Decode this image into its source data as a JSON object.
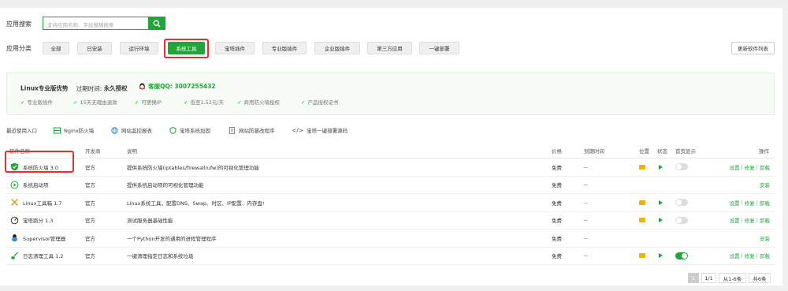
{
  "search": {
    "label": "应用搜索",
    "placeholder": "支持应用名称、字段模糊搜索"
  },
  "categories": {
    "label": "应用分类",
    "items": [
      "全部",
      "已安装",
      "运行环境",
      "系统工具",
      "宝塔插件",
      "专业版插件",
      "企业版插件",
      "第三方应用",
      "一键部署"
    ],
    "active": "系统工具"
  },
  "refresh_label": "更新软件列表",
  "promo": {
    "edition": "Linux专业版优势",
    "expire_label": "过期时间:",
    "expire_value": "永久授权",
    "support": "客服QQ: 3007255432",
    "features": [
      "专业版插件",
      "15天无理由退款",
      "可更换IP",
      "低至1.52元/天",
      "商用防火墙授权",
      "产品授权证书"
    ]
  },
  "recent": {
    "label": "最近使用入口",
    "items": [
      "Nginx防火墙",
      "网站监控报表",
      "宝塔系统加固",
      "网站防篡改程序",
      "宝塔一键部署源码"
    ]
  },
  "table": {
    "headers": [
      "软件名称",
      "开发商",
      "说明",
      "价格",
      "到期时间",
      "位置",
      "状态",
      "首页显示",
      "操作"
    ],
    "rows": [
      {
        "name": "系统防火墙 3.0",
        "vendor": "官方",
        "desc": "提供系统防火墙(iptables/firewall/ufw)的可视化管理功能",
        "price": "免费",
        "expire": "--",
        "folder": true,
        "play": true,
        "toggle": "off",
        "ops": [
          "设置",
          "修复",
          "卸载"
        ]
      },
      {
        "name": "系统启动项",
        "vendor": "官方",
        "desc": "提供系统启动项的可视化管理功能",
        "price": "免费",
        "expire": "--",
        "folder": false,
        "play": false,
        "toggle": "none",
        "ops": [
          "安装"
        ]
      },
      {
        "name": "Linux工具箱 1.7",
        "vendor": "官方",
        "desc": "Linux系统工具，配置DNS、Swap、时区、IP配置、内存盘!",
        "price": "免费",
        "expire": "--",
        "folder": true,
        "play": true,
        "toggle": "off",
        "ops": [
          "设置",
          "修复",
          "卸载"
        ]
      },
      {
        "name": "宝塔跑分 1.3",
        "vendor": "官方",
        "desc": "测试服务器基础性能",
        "price": "免费",
        "expire": "--",
        "folder": true,
        "play": true,
        "toggle": "off",
        "ops": [
          "设置",
          "修复",
          "卸载"
        ]
      },
      {
        "name": "Supervisor管理器",
        "vendor": "官方",
        "desc": "一个Python开发的通用的进程管理程序",
        "price": "免费",
        "expire": "--",
        "folder": false,
        "play": false,
        "toggle": "none",
        "ops": [
          "安装"
        ]
      },
      {
        "name": "日志清理工具 1.2",
        "vendor": "官方",
        "desc": "一键清理指定日志和系统垃圾",
        "price": "免费",
        "expire": "--",
        "folder": true,
        "play": true,
        "toggle": "on",
        "ops": [
          "设置",
          "修复",
          "卸载"
        ]
      }
    ]
  },
  "pagination": {
    "current": "1",
    "pages": "1/1",
    "range": "从1-6条",
    "total": "共6条"
  },
  "colors": {
    "accent": "#20a53a",
    "highlight": "#e5302e",
    "folder": "#f2b100"
  }
}
